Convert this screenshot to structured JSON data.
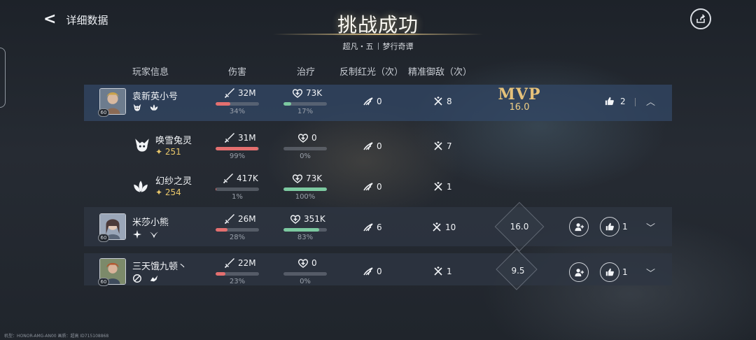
{
  "header": {
    "back_label": "详细数据",
    "title": "挑战成功",
    "subtitle_left": "超凡・五",
    "subtitle_right": "梦行奇谭"
  },
  "columns": {
    "player": "玩家信息",
    "damage": "伤害",
    "heal": "治疗",
    "counter": "反制红光（次）",
    "parry": "精准御敌（次）"
  },
  "rows": [
    {
      "kind": "player",
      "name": "袁新英小号",
      "level": "60",
      "damage": "32M",
      "damage_pct": "34%",
      "damage_frac": 0.34,
      "heal": "73K",
      "heal_pct": "17%",
      "heal_frac": 0.17,
      "counter": "0",
      "parry": "8",
      "mvp_label": "MVP",
      "score": "16.0",
      "likes": "2"
    },
    {
      "kind": "summon",
      "name": "唤雪兔灵",
      "star": "251",
      "damage": "31M",
      "damage_pct": "99%",
      "damage_frac": 0.99,
      "heal": "0",
      "heal_pct": "0%",
      "heal_frac": 0,
      "counter": "0",
      "parry": "7"
    },
    {
      "kind": "summon",
      "name": "幻纱之灵",
      "star": "254",
      "damage": "417K",
      "damage_pct": "1%",
      "damage_frac": 0.01,
      "heal": "73K",
      "heal_pct": "100%",
      "heal_frac": 1.0,
      "counter": "0",
      "parry": "1"
    },
    {
      "kind": "player",
      "name": "米莎小熊",
      "level": "60",
      "damage": "26M",
      "damage_pct": "28%",
      "damage_frac": 0.28,
      "heal": "351K",
      "heal_pct": "83%",
      "heal_frac": 0.83,
      "counter": "6",
      "parry": "10",
      "score": "16.0",
      "likes": "1"
    },
    {
      "kind": "player",
      "name": "三天饿九顿丶",
      "level": "60",
      "damage": "22M",
      "damage_pct": "23%",
      "damage_frac": 0.23,
      "heal": "0",
      "heal_pct": "0%",
      "heal_frac": 0,
      "counter": "0",
      "parry": "1",
      "score": "9.5",
      "likes": "1"
    }
  ],
  "footer": "机型：HONOR-AMG-AN00 画质：超高 ID715108868",
  "colors": {
    "damage_bar": "#e46f6f",
    "heal_bar": "#7cc9a0",
    "mvp_gold": "#e6c27a",
    "highlight_row": "#324664"
  },
  "icons": {
    "back": "back-arrow-icon",
    "share": "share-icon",
    "damage": "sword-icon",
    "heal": "heart-plus-icon",
    "counter": "slash-counter-icon",
    "parry": "crossed-swords-icon",
    "like": "thumbs-up-icon",
    "add_friend": "add-friend-icon",
    "expand": "chevron-down-icon",
    "collapse": "chevron-up-icon",
    "star": "sparkle-icon"
  }
}
